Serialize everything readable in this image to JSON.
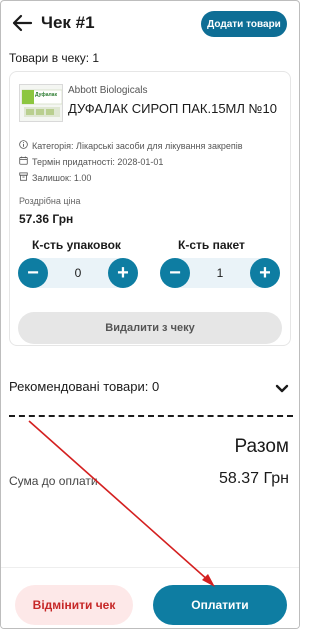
{
  "header": {
    "back_icon": "arrow-left-icon",
    "title": "Чек #1",
    "add_button": "Додати товари"
  },
  "cart": {
    "items_count_label": "Товари в чеку: 1"
  },
  "product": {
    "thumbnail_text": "Дуфалак",
    "manufacturer": "Abbott Biologicals",
    "name": "ДУФАЛАК СИРОП ПАК.15МЛ №10",
    "category": "Категорія: Лікарські засоби для лікування закрепів",
    "expiry": "Термін придатності: 2028-01-01",
    "stock": "Залишок: 1.00",
    "retail_label": "Роздрібна ціна",
    "retail_price": "57.36 Грн",
    "packs_label": "К-сть упаковок",
    "packs_value": "0",
    "units_label": "К-сть пакет",
    "units_value": "1",
    "minus": "−",
    "plus": "+",
    "remove_button": "Видалити з чеку"
  },
  "recommended": {
    "label": "Рекомендовані товари: 0",
    "icon": "chevron-down-icon"
  },
  "totals": {
    "title": "Разом",
    "sum_label": "Сума до оплати",
    "sum_value": "58.37 Грн"
  },
  "actions": {
    "cancel": "Відмінити чек",
    "pay": "Оплатити"
  },
  "colors": {
    "primary": "#0e7da2",
    "cancel_bg": "#fde8e8",
    "cancel_text": "#c62828",
    "annotation_arrow": "#d42020"
  }
}
